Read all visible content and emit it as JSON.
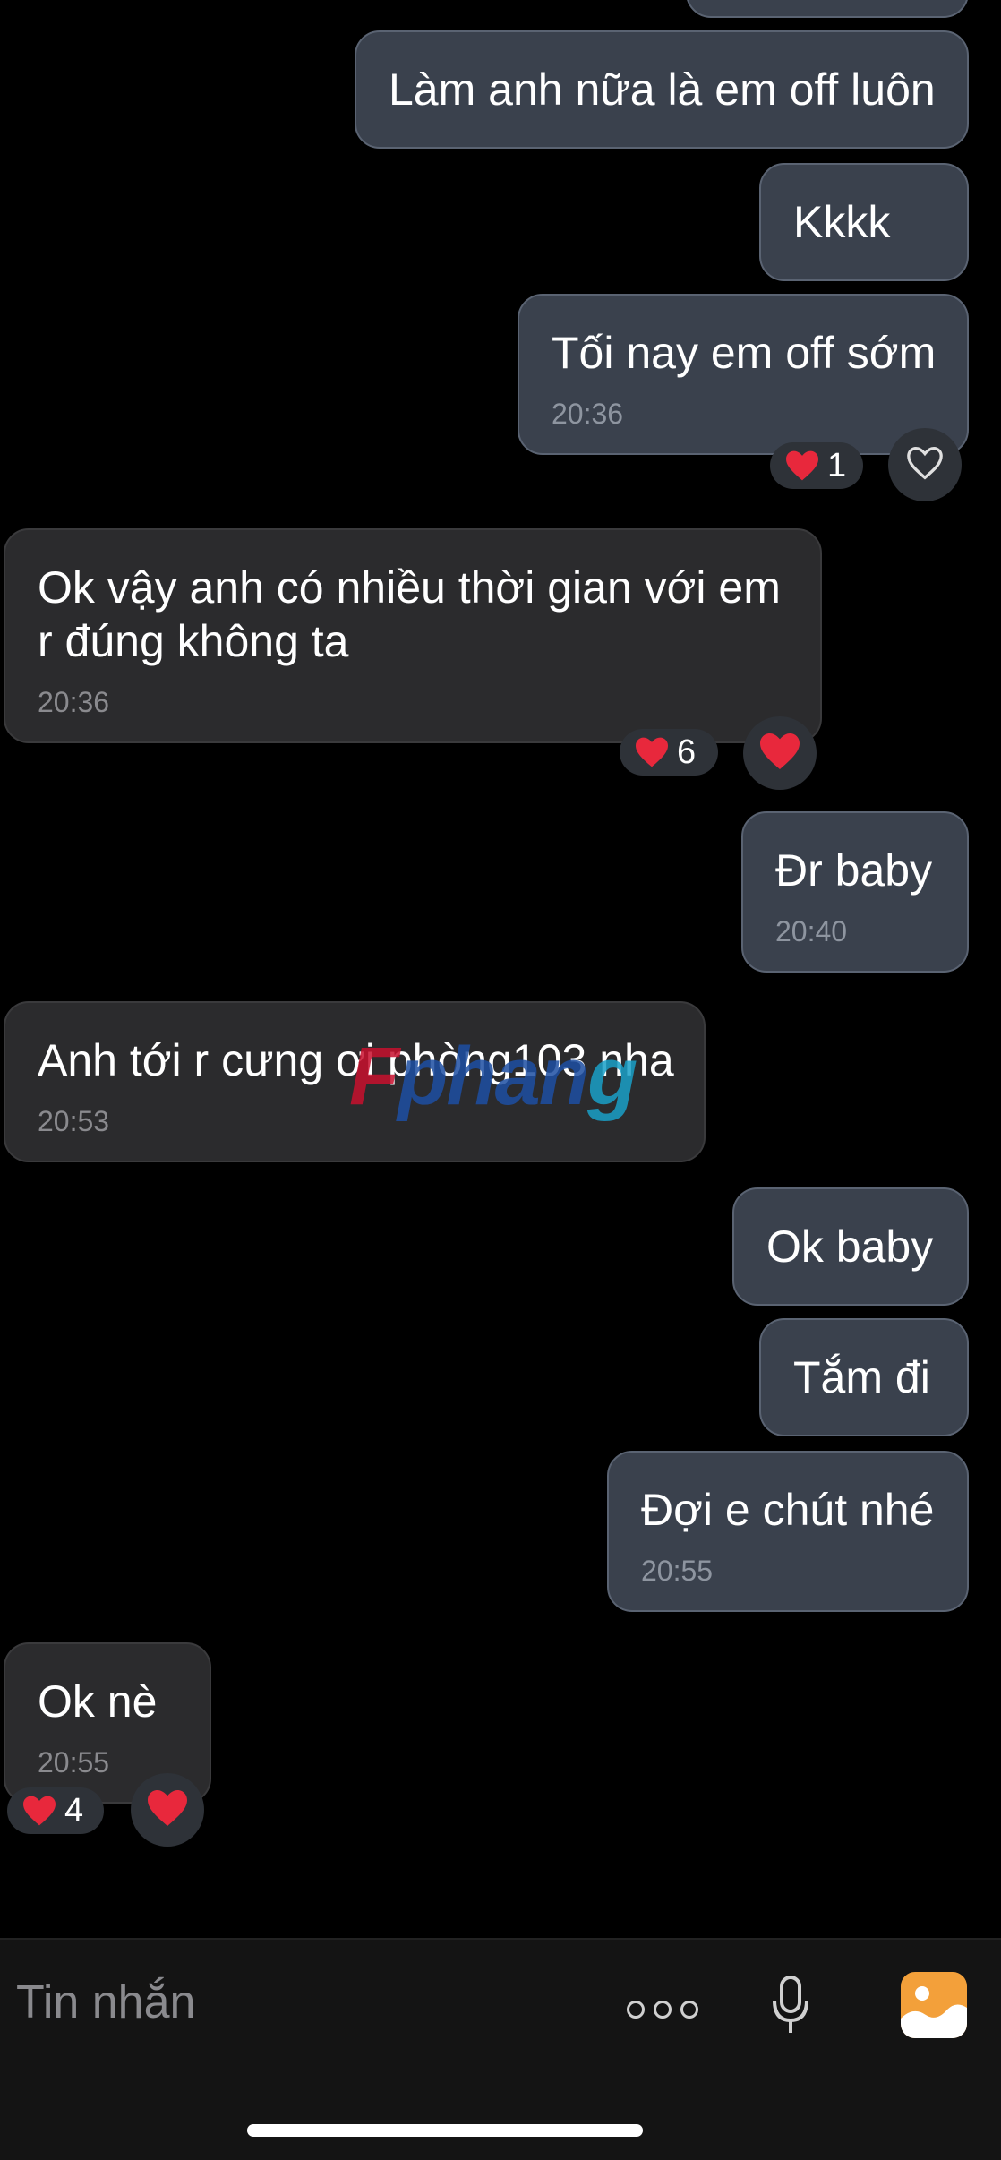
{
  "messages": [
    {
      "id": "m1",
      "sender": "me",
      "text": "Làm anh nữa là em off luôn",
      "time": ""
    },
    {
      "id": "m2",
      "sender": "me",
      "text": "Kkkk",
      "time": ""
    },
    {
      "id": "m3",
      "sender": "me",
      "text": "Tối nay em off sớm",
      "time": "20:36",
      "reaction_count": "1"
    },
    {
      "id": "m4",
      "sender": "them",
      "text": "Ok vậy anh có nhiều thời gian với em r đúng không ta",
      "time": "20:36",
      "reaction_count": "6"
    },
    {
      "id": "m5",
      "sender": "me",
      "text": "Đr baby",
      "time": "20:40"
    },
    {
      "id": "m6",
      "sender": "them",
      "text": "Anh tới r cưng ơi phòng103 nha",
      "time": "20:53"
    },
    {
      "id": "m7",
      "sender": "me",
      "text": "Ok baby",
      "time": ""
    },
    {
      "id": "m8",
      "sender": "me",
      "text": "Tắm đi",
      "time": ""
    },
    {
      "id": "m9",
      "sender": "me",
      "text": "Đợi e chút nhé",
      "time": "20:55"
    },
    {
      "id": "m10",
      "sender": "them",
      "text": "Ok nè",
      "time": "20:55",
      "reaction_count": "4"
    }
  ],
  "watermark": {
    "part1": "F",
    "part2": "phan",
    "part3": "g"
  },
  "composer": {
    "placeholder": "Tin nhắn"
  },
  "colors": {
    "heart": "#e8283c",
    "my_bubble": "#3a414d",
    "their_bubble": "#2b2b2d",
    "photo_button": "#f3a03a"
  }
}
